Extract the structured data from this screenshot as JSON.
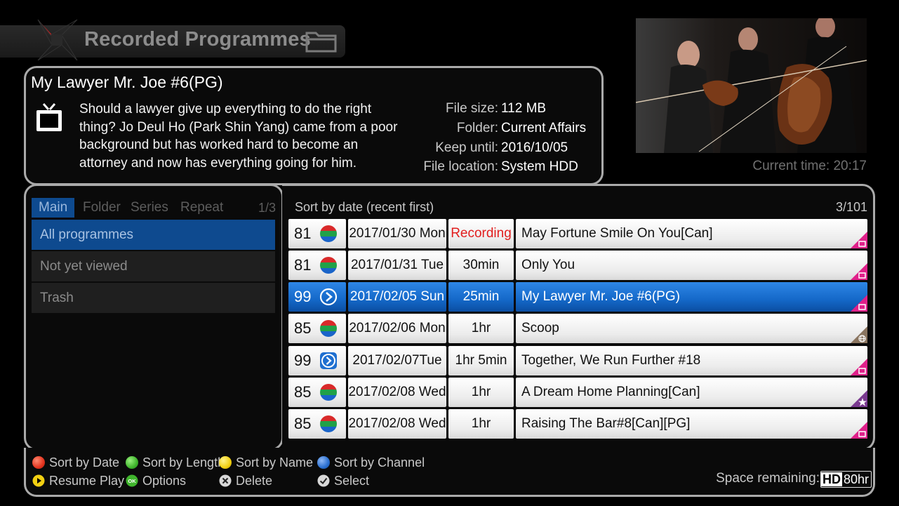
{
  "header": {
    "title": "Recorded Programmes"
  },
  "info": {
    "title": "My Lawyer Mr. Joe #6(PG)",
    "synopsis": "Should a lawyer give up everything to do the right thing? Jo Deul Ho (Park Shin Yang) came from a poor background but has worked hard to become an attorney and now has everything going for him.",
    "file_size_label": "File size:",
    "file_size": "112 MB",
    "folder_label": "Folder:",
    "folder": "Current Affairs",
    "keep_until_label": "Keep until:",
    "keep_until": "2016/10/05",
    "file_location_label": "File location:",
    "file_location": "System HDD"
  },
  "current_time": "Current time:  20:17",
  "tabs": {
    "items": [
      "Main",
      "Folder",
      "Series",
      "Repeat"
    ],
    "page": "1/3"
  },
  "nav": {
    "items": [
      "All programmes",
      "Not yet viewed",
      "Trash"
    ]
  },
  "list": {
    "sort_label": "Sort by date (recent first)",
    "count": "3/101",
    "rows": [
      {
        "channel": "81",
        "date": "2017/01/30 Mon",
        "duration": "Recording",
        "title": "May Fortune Smile On You[Can]"
      },
      {
        "channel": "81",
        "date": "2017/01/31 Tue",
        "duration": "30min",
        "title": "Only You"
      },
      {
        "channel": "99",
        "date": "2017/02/05 Sun",
        "duration": "25min",
        "title": "My Lawyer Mr. Joe #6(PG)"
      },
      {
        "channel": "85",
        "date": "2017/02/06 Mon",
        "duration": "1hr",
        "title": "Scoop"
      },
      {
        "channel": "99",
        "date": "2017/02/07Tue",
        "duration": "1hr 5min",
        "title": "Together, We Run Further #18"
      },
      {
        "channel": "85",
        "date": "2017/02/08 Wed",
        "duration": "1hr",
        "title": "A Dream Home Planning[Can]"
      },
      {
        "channel": "85",
        "date": "2017/02/08 Wed",
        "duration": "1hr",
        "title": "Raising The Bar#8[Can][PG]"
      }
    ]
  },
  "legend": {
    "sort_date": "Sort by Date",
    "sort_length": "Sort by Length",
    "sort_name": "Sort by Name",
    "sort_channel": "Sort by Channel",
    "resume_play": "Resume Play",
    "options": "Options",
    "delete": "Delete",
    "select": "Select",
    "ok_glyph": "OK"
  },
  "space": {
    "label": "Space remaining:",
    "hd": "HD",
    "value": "80hr"
  },
  "colors": {
    "selected_blue": "#1468c8",
    "nav_selected": "#0e4a8f",
    "recording_red": "#e11d1d",
    "btn_red": "#e4341f",
    "btn_green": "#3fb52c",
    "btn_yellow": "#f2d012",
    "btn_blue": "#2a6fcf",
    "corner_pink": "#e0208a",
    "corner_brown": "#8a7560",
    "corner_purple": "#7a3a90"
  }
}
